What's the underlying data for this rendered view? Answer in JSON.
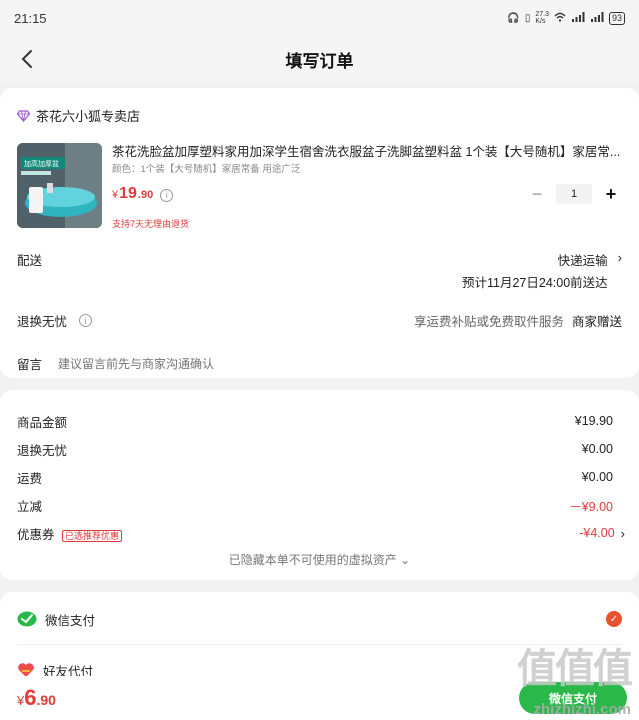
{
  "status_bar": {
    "time": "21:15",
    "network_speed": "27.3\nK/s",
    "battery": "93"
  },
  "nav": {
    "title": "填写订单"
  },
  "shop": {
    "name": "茶花六小狐专卖店"
  },
  "product": {
    "thumb_text_top": "加高加厚盆",
    "title": "茶花洗脸盆加厚塑料家用加深学生宿舍洗衣服盆子洗脚盆塑料盆 1个装【大号随机】家居常...",
    "spec": "颜色：1个装【大号随机】家居常备 用途广泛",
    "price_currency": "¥",
    "price_int": "19",
    "price_dec": ".90",
    "quantity": "1",
    "refund_tag": "支持7天无理由退货"
  },
  "delivery": {
    "label": "配送",
    "method": "快递运输",
    "eta": "预计11月27日24:00前送达"
  },
  "exchange": {
    "label": "退换无忧",
    "desc": "享运费补贴或免费取件服务",
    "gift": "商家赠送"
  },
  "message": {
    "label": "留言",
    "placeholder": "建议留言前先与商家沟通确认"
  },
  "summary": {
    "items": [
      {
        "label": "商品金额",
        "value": "¥19.90",
        "red": false
      },
      {
        "label": "退换无忧",
        "value": "¥0.00",
        "red": false
      },
      {
        "label": "运费",
        "value": "¥0.00",
        "red": false
      },
      {
        "label": "立减",
        "value": "－¥9.00",
        "red": true
      }
    ],
    "coupon_label": "优惠券",
    "coupon_tag": "已选推荐优惠",
    "coupon_value": "-¥4.00",
    "hidden_assets": "已隐藏本单不可使用的虚拟资产 ⌄"
  },
  "payment": {
    "wechat": "微信支付",
    "friend": "好友代付"
  },
  "bottom": {
    "currency": "¥",
    "total_int": "6",
    "total_dec": ".90",
    "pay_button": "微信支付"
  },
  "watermark": {
    "glyphs": "值值值",
    "text": "zhizhizhi.com"
  },
  "colors": {
    "accent_red": "#e03a3a",
    "wechat_green": "#2ab84a",
    "check_orange": "#e8532c"
  }
}
